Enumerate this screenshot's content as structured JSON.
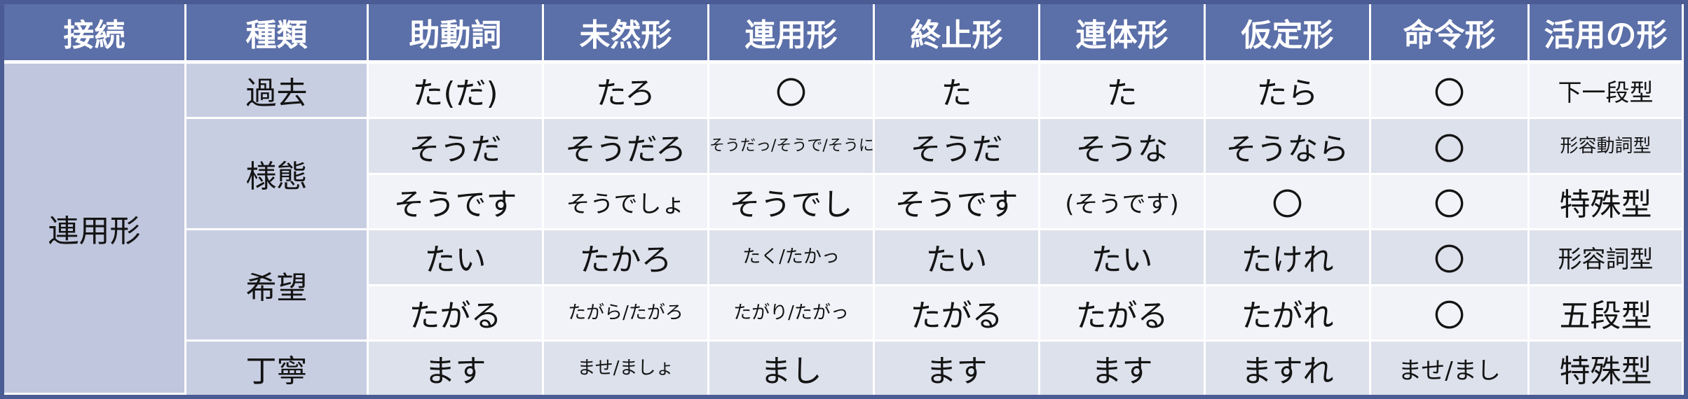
{
  "headers": [
    "接続",
    "種類",
    "助動詞",
    "未然形",
    "連用形",
    "終止形",
    "連体形",
    "仮定形",
    "命令形",
    "活用の形"
  ],
  "connection": "連用形",
  "groups": [
    {
      "type": "過去",
      "rows": [
        [
          "た(だ)",
          "たろ",
          "〇",
          "た",
          "た",
          "たら",
          "〇",
          "下一段型"
        ]
      ]
    },
    {
      "type": "様態",
      "rows": [
        [
          "そうだ",
          "そうだろ",
          "そうだっ/そうで/そうに",
          "そうだ",
          "そうな",
          "そうなら",
          "〇",
          "形容動詞型"
        ],
        [
          "そうです",
          "そうでしょ",
          "そうでし",
          "そうです",
          "(そうです)",
          "〇",
          "〇",
          "特殊型"
        ]
      ]
    },
    {
      "type": "希望",
      "rows": [
        [
          "たい",
          "たかろ",
          "たく/たかっ",
          "たい",
          "たい",
          "たけれ",
          "〇",
          "形容詞型"
        ],
        [
          "たがる",
          "たがら/たがろ",
          "たがり/たがっ",
          "たがる",
          "たがる",
          "たがれ",
          "〇",
          "五段型"
        ]
      ]
    },
    {
      "type": "丁寧",
      "rows": [
        [
          "ます",
          "ませ/ましょ",
          "まし",
          "ます",
          "ます",
          "ますれ",
          "ませ/まし",
          "特殊型"
        ]
      ]
    }
  ]
}
